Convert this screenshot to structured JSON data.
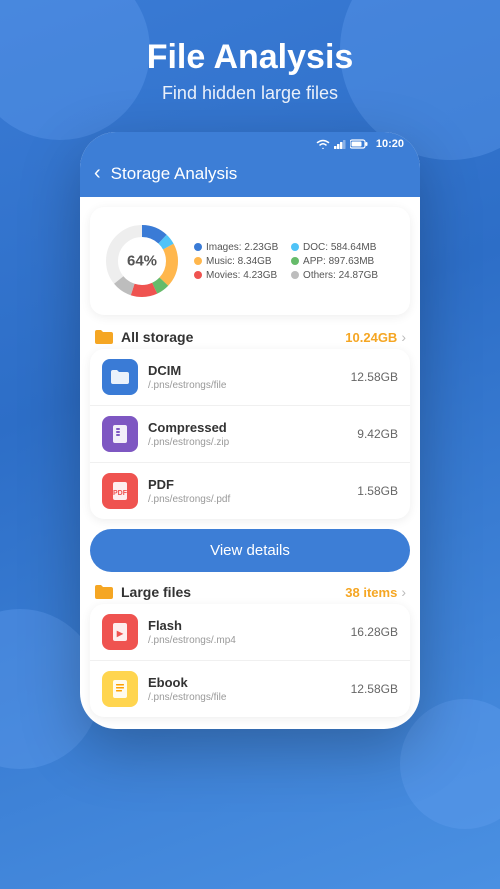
{
  "page": {
    "title": "File Analysis",
    "subtitle": "Find hidden large files",
    "background_color": "#3a7bd6"
  },
  "phone": {
    "status_bar": {
      "time": "10:20"
    },
    "nav": {
      "back_label": "‹",
      "title": "Storage Analysis"
    },
    "chart": {
      "percent": "64%",
      "legend": [
        {
          "label": "Images:",
          "value": "2.23GB",
          "color": "#3a7bd6"
        },
        {
          "label": "DOC:",
          "value": "584.64MB",
          "color": "#4fc3f7"
        },
        {
          "label": "Music:",
          "value": "8.34GB",
          "color": "#ffb74d"
        },
        {
          "label": "APP:",
          "value": "897.63MB",
          "color": "#66bb6a"
        },
        {
          "label": "Movies:",
          "value": "4.23GB",
          "color": "#ef5350"
        },
        {
          "label": "Others:",
          "value": "24.87GB",
          "color": "#bdbdbd"
        }
      ],
      "donut_segments": [
        {
          "label": "Images",
          "color": "#3a7bd6",
          "percent": 12
        },
        {
          "label": "DOC",
          "color": "#4fc3f7",
          "percent": 5
        },
        {
          "label": "Music",
          "color": "#ffb74d",
          "percent": 20
        },
        {
          "label": "APP",
          "color": "#66bb6a",
          "percent": 6
        },
        {
          "label": "Movies",
          "color": "#ef5350",
          "percent": 12
        },
        {
          "label": "Others",
          "color": "#bdbdbd",
          "percent": 9
        }
      ]
    },
    "all_storage": {
      "icon_color": "#f5a623",
      "label": "All storage",
      "size": "10.24GB",
      "files": [
        {
          "name": "DCIM",
          "path": "/.pns/estrongs/file",
          "size": "12.58GB",
          "icon_bg": "#3a7bd6",
          "icon": "folder"
        },
        {
          "name": "Compressed",
          "path": "/.pns/estrongs/.zip",
          "size": "9.42GB",
          "icon_bg": "#7e57c2",
          "icon": "zip"
        },
        {
          "name": "PDF",
          "path": "/.pns/estrongs/.pdf",
          "size": "1.58GB",
          "icon_bg": "#ef5350",
          "icon": "pdf"
        }
      ]
    },
    "view_details_btn": "View details",
    "large_files": {
      "icon_color": "#f5a623",
      "label": "Large files",
      "badge": "38 items",
      "files": [
        {
          "name": "Flash",
          "path": "/.pns/estrongs/.mp4",
          "size": "16.28GB",
          "icon_bg": "#ef5350",
          "icon": "flash"
        },
        {
          "name": "Ebook",
          "path": "/.pns/estrongs/file",
          "size": "12.58GB",
          "icon_bg": "#ffd54f",
          "icon": "ebook"
        }
      ]
    }
  }
}
